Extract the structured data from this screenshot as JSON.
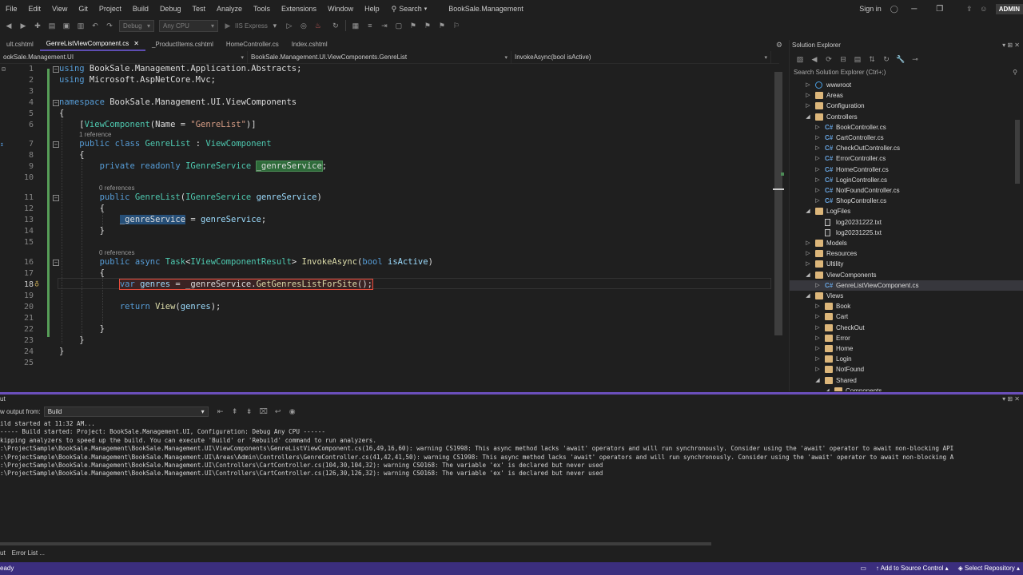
{
  "menu": {
    "items": [
      "File",
      "Edit",
      "View",
      "Git",
      "Project",
      "Build",
      "Debug",
      "Test",
      "Analyze",
      "Tools",
      "Extensions",
      "Window",
      "Help"
    ],
    "search_label": "Search",
    "solution_name": "BookSale.Management",
    "sign_in": "Sign in",
    "admin_badge": "ADMIN"
  },
  "toolbar": {
    "config_combo": "Debug",
    "platform_combo": "Any CPU",
    "run_label": "IIS Express"
  },
  "doc_tabs": [
    {
      "label": "ult.cshtml",
      "active": false
    },
    {
      "label": "GenreListViewComponent.cs",
      "active": true
    },
    {
      "label": "_ProductItems.cshtml",
      "active": false
    },
    {
      "label": "HomeController.cs",
      "active": false
    },
    {
      "label": "Index.cshtml",
      "active": false
    }
  ],
  "navbar": {
    "project": "ookSale.Management.UI",
    "type": "BookSale.Management.UI.ViewComponents.GenreList",
    "member": "InvokeAsync(bool isActive)"
  },
  "code": {
    "references": [
      "1 reference",
      "0 references",
      "0 references"
    ],
    "line_numbers": [
      "1",
      "2",
      "3",
      "4",
      "5",
      "6",
      "7",
      "8",
      "9",
      "10",
      "11",
      "12",
      "13",
      "14",
      "15",
      "16",
      "17",
      "18",
      "19",
      "20",
      "21",
      "22",
      "23",
      "24",
      "25"
    ]
  },
  "solution_explorer": {
    "title": "Solution Explorer",
    "search_placeholder": "Search Solution Explorer (Ctrl+;)",
    "items": [
      {
        "label": "wwwroot",
        "kind": "globe",
        "depth": 1,
        "expanded": false
      },
      {
        "label": "Areas",
        "kind": "folder",
        "depth": 1,
        "expanded": false
      },
      {
        "label": "Configuration",
        "kind": "folder",
        "depth": 1,
        "expanded": false
      },
      {
        "label": "Controllers",
        "kind": "folder",
        "depth": 1,
        "expanded": true
      },
      {
        "label": "BookController.cs",
        "kind": "cs",
        "depth": 2,
        "expanded": false
      },
      {
        "label": "CartController.cs",
        "kind": "cs",
        "depth": 2,
        "expanded": false
      },
      {
        "label": "CheckOutController.cs",
        "kind": "cs",
        "depth": 2,
        "expanded": false
      },
      {
        "label": "ErrorController.cs",
        "kind": "cs",
        "depth": 2,
        "expanded": false
      },
      {
        "label": "HomeController.cs",
        "kind": "cs",
        "depth": 2,
        "expanded": false
      },
      {
        "label": "LoginController.cs",
        "kind": "cs",
        "depth": 2,
        "expanded": false
      },
      {
        "label": "NotFoundController.cs",
        "kind": "cs",
        "depth": 2,
        "expanded": false
      },
      {
        "label": "ShopController.cs",
        "kind": "cs",
        "depth": 2,
        "expanded": false
      },
      {
        "label": "LogFiles",
        "kind": "folder",
        "depth": 1,
        "expanded": true
      },
      {
        "label": "log20231222.txt",
        "kind": "txt",
        "depth": 2,
        "expanded": null
      },
      {
        "label": "log20231225.txt",
        "kind": "txt",
        "depth": 2,
        "expanded": null
      },
      {
        "label": "Models",
        "kind": "folder",
        "depth": 1,
        "expanded": false
      },
      {
        "label": "Resources",
        "kind": "folder",
        "depth": 1,
        "expanded": false
      },
      {
        "label": "Ultility",
        "kind": "folder",
        "depth": 1,
        "expanded": false
      },
      {
        "label": "ViewComponents",
        "kind": "folder",
        "depth": 1,
        "expanded": true
      },
      {
        "label": "GenreListViewComponent.cs",
        "kind": "cs",
        "depth": 2,
        "expanded": false,
        "selected": true
      },
      {
        "label": "Views",
        "kind": "folder",
        "depth": 1,
        "expanded": true
      },
      {
        "label": "Book",
        "kind": "folder",
        "depth": 2,
        "expanded": false
      },
      {
        "label": "Cart",
        "kind": "folder",
        "depth": 2,
        "expanded": false
      },
      {
        "label": "CheckOut",
        "kind": "folder",
        "depth": 2,
        "expanded": false
      },
      {
        "label": "Error",
        "kind": "folder",
        "depth": 2,
        "expanded": false
      },
      {
        "label": "Home",
        "kind": "folder",
        "depth": 2,
        "expanded": false
      },
      {
        "label": "Login",
        "kind": "folder",
        "depth": 2,
        "expanded": false
      },
      {
        "label": "NotFound",
        "kind": "folder",
        "depth": 2,
        "expanded": false
      },
      {
        "label": "Shared",
        "kind": "folder",
        "depth": 2,
        "expanded": true
      },
      {
        "label": "Components",
        "kind": "folder",
        "depth": 3,
        "expanded": true
      }
    ]
  },
  "output": {
    "title": "ut",
    "show_from_label": "w output from:",
    "source": "Build",
    "lines": [
      "ild started at 11:32 AM...",
      "----- Build started: Project: BookSale.Management.UI, Configuration: Debug Any CPU ------",
      "kipping analyzers to speed up the build. You can execute 'Build' or 'Rebuild' command to run analyzers.",
      ":\\ProjectSample\\BookSale.Management\\BookSale.Management.UI\\ViewComponents\\GenreListViewComponent.cs(16,49,16,60): warning CS1998: This async method lacks 'await' operators and will run synchronously. Consider using the 'await' operator to await non-blocking API",
      ":\\ProjectSample\\BookSale.Management\\BookSale.Management.UI\\Areas\\Admin\\Controllers\\GenreController.cs(41,42,41,50): warning CS1998: This async method lacks 'await' operators and will run synchronously. Consider using the 'await' operator to await non-blocking A",
      ":\\ProjectSample\\BookSale.Management\\BookSale.Management.UI\\Controllers\\CartController.cs(104,30,104,32): warning CS0168: The variable 'ex' is declared but never used",
      ":\\ProjectSample\\BookSale.Management\\BookSale.Management.UI\\Controllers\\CartController.cs(126,30,126,32): warning CS0168: The variable 'ex' is declared but never used"
    ]
  },
  "bottom_tabs": [
    "ut",
    "Error List ..."
  ],
  "status": {
    "left": "eady",
    "source_control": "Add to Source Control",
    "repository": "Select Repository"
  }
}
